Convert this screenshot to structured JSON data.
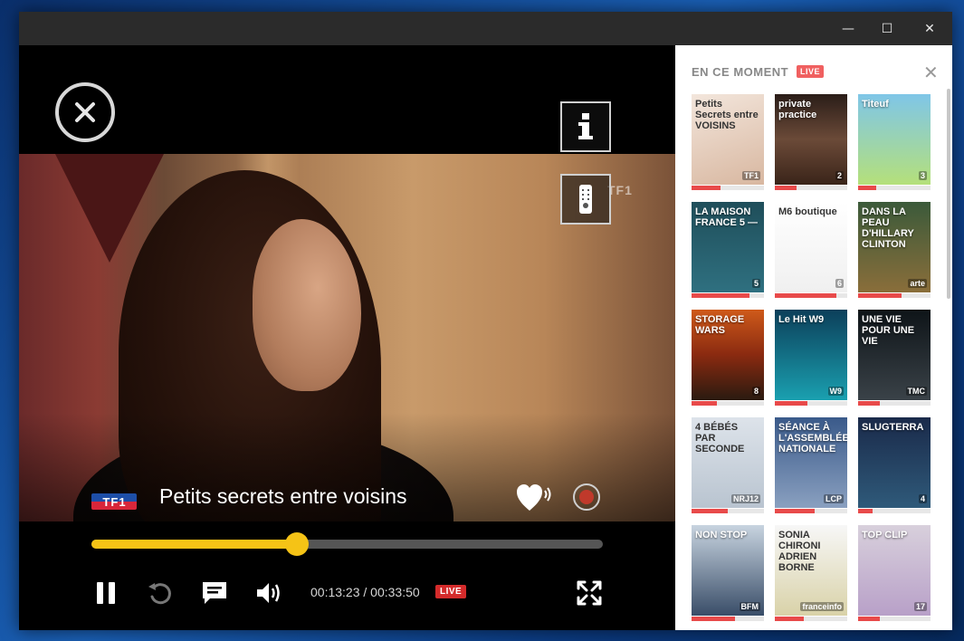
{
  "window": {
    "minimize_glyph": "—",
    "maximize_glyph": "☐",
    "close_glyph": "✕"
  },
  "player": {
    "watermark": "TF1",
    "channel_logo": [
      "T",
      "F",
      "1"
    ],
    "program_title": "Petits secrets entre voisins",
    "progress_fraction": 0.402,
    "time_text": "00:13:23 / 00:33:50",
    "live_label": "LIVE"
  },
  "sidebar": {
    "heading": "EN CE MOMENT",
    "live_label": "LIVE",
    "close_glyph": "✕",
    "tiles": [
      {
        "caption": "Petits Secrets entre VOISINS",
        "channel": "TF1",
        "progress": 0.4,
        "bg": "linear-gradient(160deg,#f3e6dc,#d8b7a0)",
        "dark": true
      },
      {
        "caption": "private practice",
        "channel": "2",
        "progress": 0.3,
        "bg": "linear-gradient(180deg,#2a1d18,#6b4a38,#3a2419)",
        "dark": false
      },
      {
        "caption": "Titeuf",
        "channel": "3",
        "progress": 0.25,
        "bg": "linear-gradient(180deg,#7fc6e8,#b5e07a)",
        "dark": false
      },
      {
        "caption": "LA MAISON FRANCE 5 —",
        "channel": "5",
        "progress": 0.8,
        "bg": "linear-gradient(180deg,#1f4e5a,#2f7080)",
        "dark": false
      },
      {
        "caption": "M6 boutique",
        "channel": "6",
        "progress": 0.85,
        "bg": "linear-gradient(180deg,#ffffff,#f0f0f0)",
        "dark": true
      },
      {
        "caption": "DANS LA PEAU D'HILLARY CLINTON",
        "channel": "arte",
        "progress": 0.6,
        "bg": "linear-gradient(180deg,#3b5a3a,#8a6e3a)",
        "dark": false
      },
      {
        "caption": "STORAGE WARS",
        "channel": "8",
        "progress": 0.35,
        "bg": "linear-gradient(180deg,#cf5a1a,#8a2a10,#2a1a10)",
        "dark": false
      },
      {
        "caption": "Le Hit W9",
        "channel": "W9",
        "progress": 0.45,
        "bg": "linear-gradient(180deg,#0c3f5a,#1aa0b0)",
        "dark": false
      },
      {
        "caption": "UNE VIE POUR UNE VIE",
        "channel": "TMC",
        "progress": 0.3,
        "bg": "linear-gradient(180deg,#0e1418,#3a4248)",
        "dark": false
      },
      {
        "caption": "4 BÉBÉS PAR SECONDE",
        "channel": "NRJ12",
        "progress": 0.5,
        "bg": "linear-gradient(180deg,#dde3ea,#b9c4d0)",
        "dark": true
      },
      {
        "caption": "SÉANCE À L'ASSEMBLÉE NATIONALE",
        "channel": "LCP",
        "progress": 0.55,
        "bg": "linear-gradient(180deg,#3a5a8a,#8aa0c0)",
        "dark": false
      },
      {
        "caption": "SLUGTERRA",
        "channel": "4",
        "progress": 0.2,
        "bg": "linear-gradient(180deg,#1a2a4a,#2f5a7a)",
        "dark": false
      },
      {
        "caption": "NON STOP",
        "channel": "BFM",
        "progress": 0.6,
        "bg": "linear-gradient(180deg,#c8d4e0,#394d68)",
        "dark": false
      },
      {
        "caption": "SONIA CHIRONI ADRIEN BORNE",
        "channel": "franceinfo",
        "progress": 0.4,
        "bg": "linear-gradient(180deg,#f7f7f7,#d9d2a8)",
        "dark": true
      },
      {
        "caption": "TOP CLIP",
        "channel": "17",
        "progress": 0.3,
        "bg": "linear-gradient(180deg,#d8d0dc,#b8a0c8)",
        "dark": false
      }
    ]
  }
}
